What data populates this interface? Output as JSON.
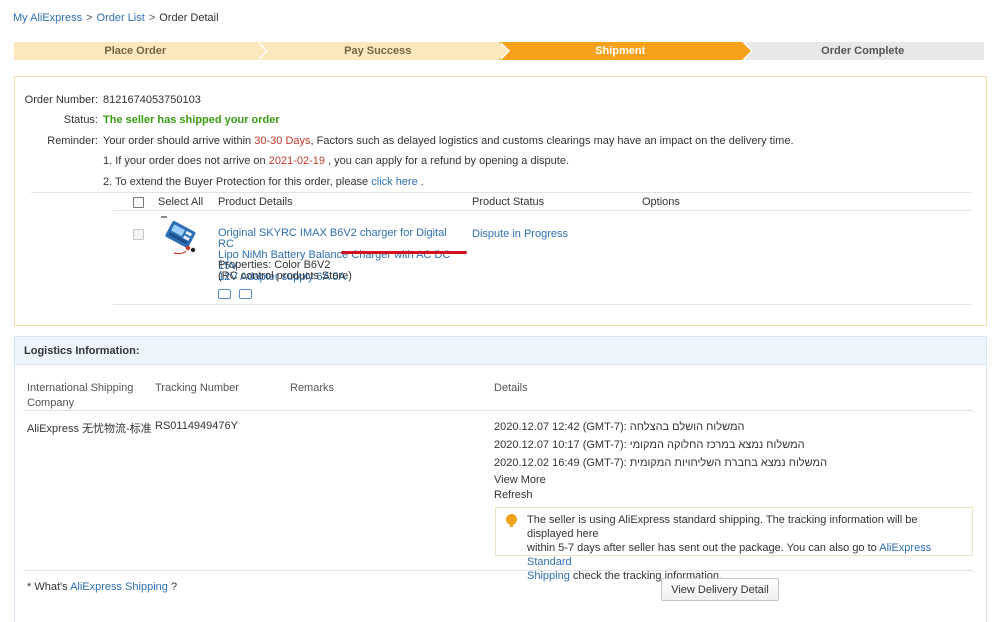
{
  "breadcrumb": {
    "home": "My AliExpress",
    "sep": ">",
    "list": "Order List",
    "current": "Order Detail"
  },
  "steps": [
    "Place Order",
    "Pay Success",
    "Shipment",
    "Order Complete"
  ],
  "order": {
    "number_label": "Order Number:",
    "number": "8121674053750103",
    "status_label": "Status:",
    "status": "The seller has shipped your order",
    "reminder_label": "Reminder:",
    "reminder_pre": "Your order should arrive within",
    "reminder_days": "30-30 Days",
    "reminder_post": ", Factors such as delayed logistics and customs clearings may have an impact on the delivery time.",
    "line1_pre": "1. If your order does not arrive on",
    "line1_date": "2021-02-19",
    "line1_post": ", you can apply for a refund by opening a dispute.",
    "line2_pre": "2. To extend the Buyer Protection for this order, please",
    "line2_link": "click here",
    "line2_post": ".",
    "table": {
      "select_all": "Select All",
      "product_details": "Product Details",
      "product_status": "Product Status",
      "options": "Options"
    },
    "product": {
      "title_line1": "Original SKYRC IMAX B6V2 charger for Digital RC",
      "title_line2": "Lipo NiMh Battery Balance Charger with AC DC 15V",
      "title_line3": "12V Adapter supply 6A 5A",
      "properties": "Properties: Color B6V2",
      "store": "(RC control products Store)",
      "status": "Dispute in Progress"
    }
  },
  "logistics": {
    "heading": "Logistics Information:",
    "columns": {
      "company_line1": "International Shipping",
      "company_line2": "Company",
      "tracking": "Tracking Number",
      "remarks": "Remarks",
      "details": "Details"
    },
    "company": "AliExpress 无忧物流-标准",
    "tracking_number": "RS0114949476Y",
    "events": [
      "2020.12.07 12:42 (GMT-7): המשלוח הושלם בהצלחה",
      "2020.12.07 10:17 (GMT-7): המשלוח נמצא במרכז החלוקה המקומי",
      "2020.12.02 16:49 (GMT-7): המשלוח נמצא בחברת השליחויות המקומית"
    ],
    "view_more": "View More",
    "refresh": "Refresh",
    "note_line1": "The seller is using AliExpress standard shipping. The tracking information will be displayed here",
    "note_line2": "within 5-7 days after seller has sent out the package. You can also go to",
    "note_link1": "AliExpress Standard",
    "note_link2": "Shipping",
    "note_line3": "check the tracking information.",
    "footer_pre": "* What's",
    "footer_link": "AliExpress Shipping",
    "footer_post": "?",
    "button": "View Delivery Detail"
  }
}
